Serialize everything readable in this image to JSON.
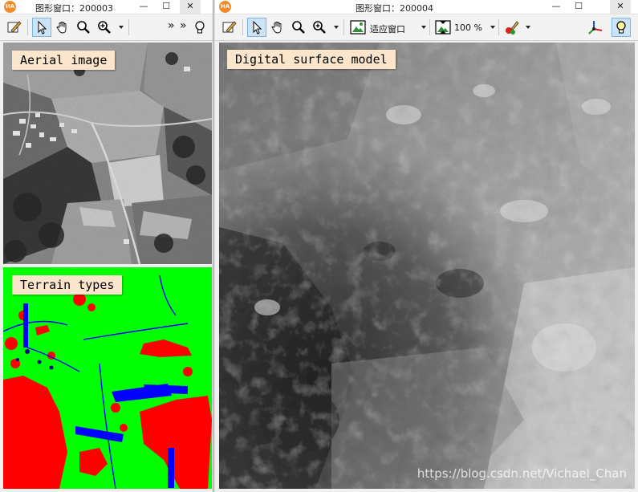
{
  "left_window": {
    "title": "图形窗口：200003",
    "app_icon_text": "HA",
    "minimize": "—",
    "maximize": "☐",
    "close": "✕",
    "overflow_1": "»",
    "overflow_2": "»",
    "tools": [
      "draw-tool",
      "pointer-tool",
      "pan-tool",
      "magnifier-tool",
      "zoom-tool",
      "lightbulb-tool"
    ],
    "top_image_label": "Aerial image",
    "bottom_image_label": "Terrain types"
  },
  "right_window": {
    "title": "图形窗口：200004",
    "app_icon_text": "HA",
    "minimize": "—",
    "maximize": "☐",
    "close": "✕",
    "fit_window_label": "适应窗口",
    "zoom_value": "100 %",
    "image_label": "Digital surface model",
    "watermark": "https://blog.csdn.net/Vichael_Chan"
  },
  "colors": {
    "terrain_forest": "#ff0000",
    "terrain_meadow": "#00ff00",
    "terrain_water": "#0000ff",
    "label_bg": "#fbe6cc"
  }
}
